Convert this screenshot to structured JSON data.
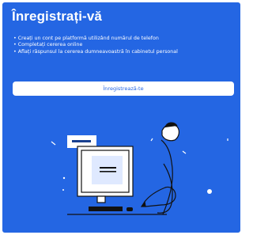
{
  "page": {
    "title": "Înregistrați-vă",
    "bullets": [
      "Creați un cont pe platformă utilizând numărul de telefon",
      "Completați cererea online",
      "Aflați răspunsul la cererea dumneavoastră în cabinetul personal"
    ],
    "cta_label": "Înregistrează-te"
  },
  "illustration": {
    "icon": "person-at-computer-illustration"
  },
  "colors": {
    "background": "#2466e3",
    "text": "#ffffff",
    "button_bg": "#ffffff",
    "button_text": "#2466e3"
  }
}
